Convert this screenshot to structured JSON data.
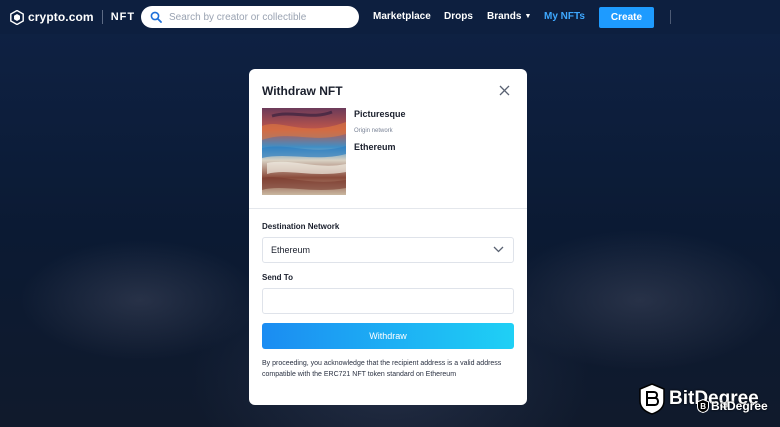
{
  "header": {
    "brand": "crypto.com",
    "product": "NFT",
    "search_placeholder": "Search by creator or collectible",
    "nav": {
      "marketplace": "Marketplace",
      "drops": "Drops",
      "brands": "Brands",
      "my_nfts": "My NFTs"
    },
    "create_label": "Create",
    "accent_color": "#1e9bff"
  },
  "modal": {
    "title": "Withdraw NFT",
    "nft_name": "Picturesque",
    "origin_label": "Origin network",
    "origin_value": "Ethereum",
    "destination_label": "Destination Network",
    "destination_value": "Ethereum",
    "send_to_label": "Send To",
    "send_to_value": "",
    "withdraw_label": "Withdraw",
    "disclaimer": "By proceeding, you acknowledge that the recipient address is a valid address compatible with the ERC721 NFT token standard on Ethereum"
  },
  "watermark": {
    "text": "BitDegree",
    "sub_text": "BitDegree"
  },
  "icons": {
    "search": "search-icon",
    "close": "close-icon",
    "chevron": "chevron-down-icon",
    "logo": "crypto-com-logo-icon"
  }
}
